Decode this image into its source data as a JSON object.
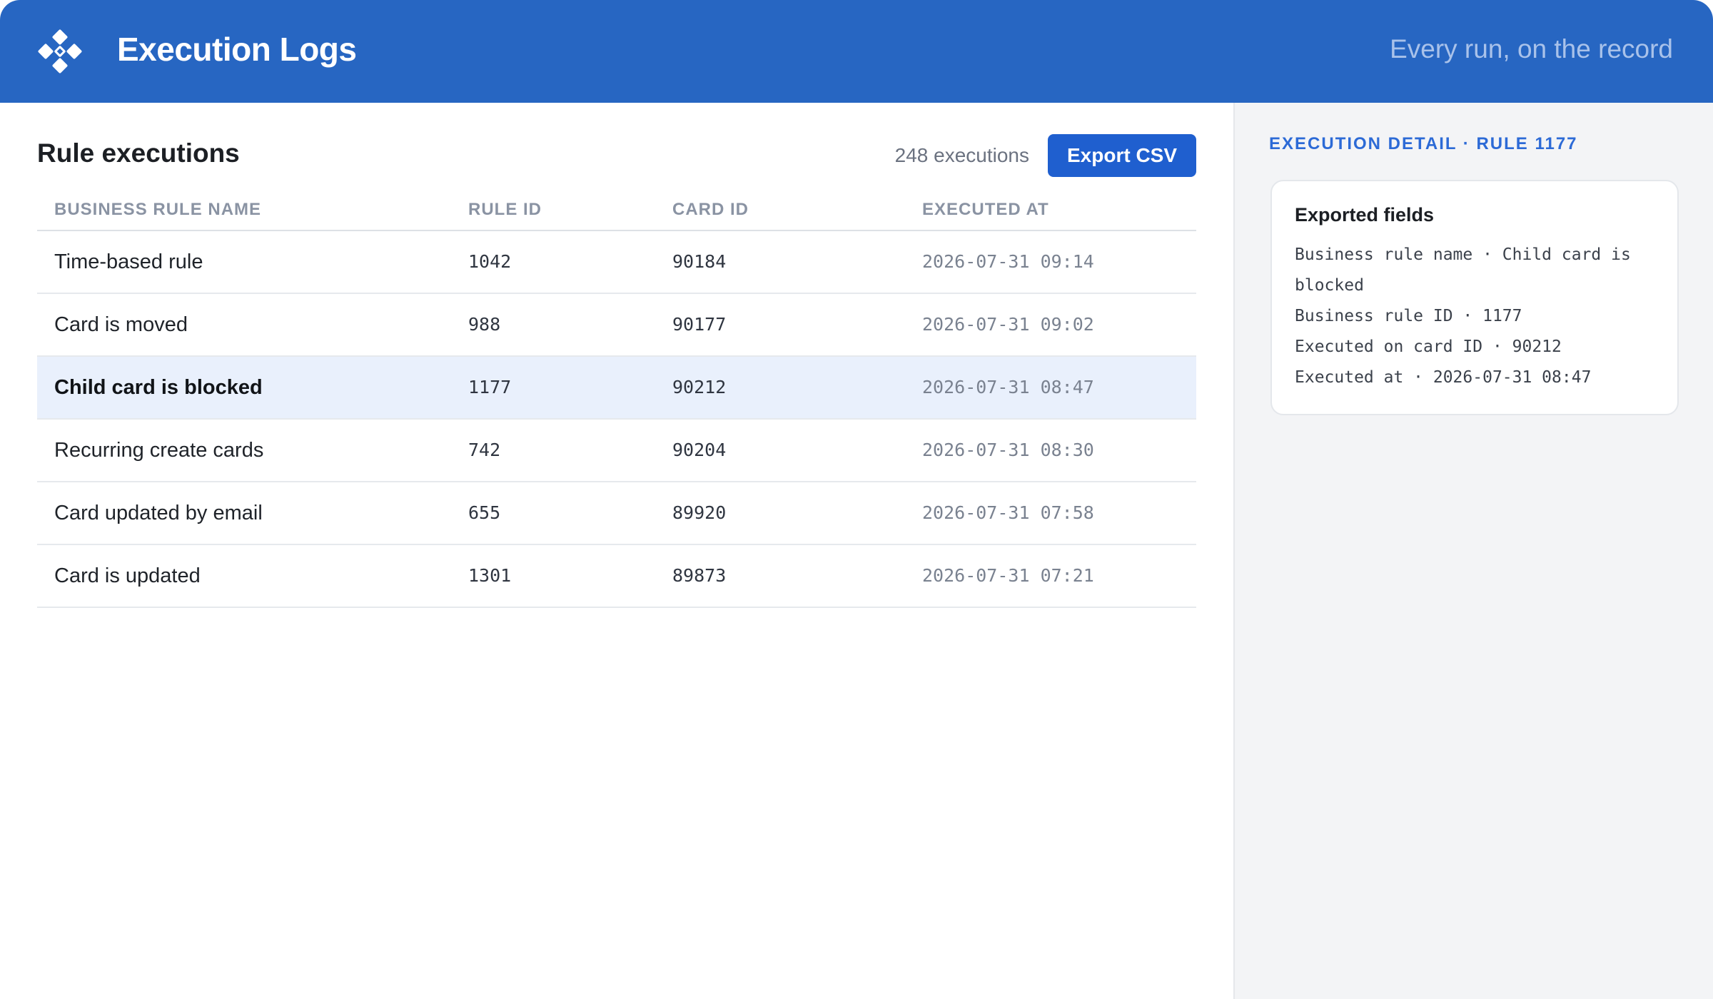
{
  "header": {
    "title": "Execution Logs",
    "tagline": "Every run, on the record",
    "logo_icon": "diamond-grid-icon",
    "background": "#2766c2"
  },
  "main": {
    "title": "Rule executions",
    "count_text": "248 executions",
    "export_label": "Export CSV",
    "columns": [
      "BUSINESS RULE NAME",
      "RULE ID",
      "CARD ID",
      "EXECUTED AT"
    ],
    "rows": [
      {
        "name": "Time-based rule",
        "rule_id": "1042",
        "card_id": "90184",
        "executed_at": "2026-07-31 09:14"
      },
      {
        "name": "Card is moved",
        "rule_id": "988",
        "card_id": "90177",
        "executed_at": "2026-07-31 09:02"
      },
      {
        "name": "Child card is blocked",
        "rule_id": "1177",
        "card_id": "90212",
        "executed_at": "2026-07-31 08:47"
      },
      {
        "name": "Recurring create cards",
        "rule_id": "742",
        "card_id": "90204",
        "executed_at": "2026-07-31 08:30"
      },
      {
        "name": "Card updated by email",
        "rule_id": "655",
        "card_id": "89920",
        "executed_at": "2026-07-31 07:58"
      },
      {
        "name": "Card is updated",
        "rule_id": "1301",
        "card_id": "89873",
        "executed_at": "2026-07-31 07:21"
      }
    ],
    "selected_index": 2
  },
  "detail": {
    "heading": "EXECUTION DETAIL · RULE 1177",
    "card_title": "Exported fields",
    "lines": [
      "Business rule name · Child card is blocked",
      "Business rule ID · 1177",
      "Executed on card ID · 90212",
      "Executed at · 2026-07-31 08:47"
    ]
  },
  "colors": {
    "accent": "#1f5fcf",
    "selected_row": "#e9f0fc",
    "side_heading": "#2c6ad6"
  }
}
